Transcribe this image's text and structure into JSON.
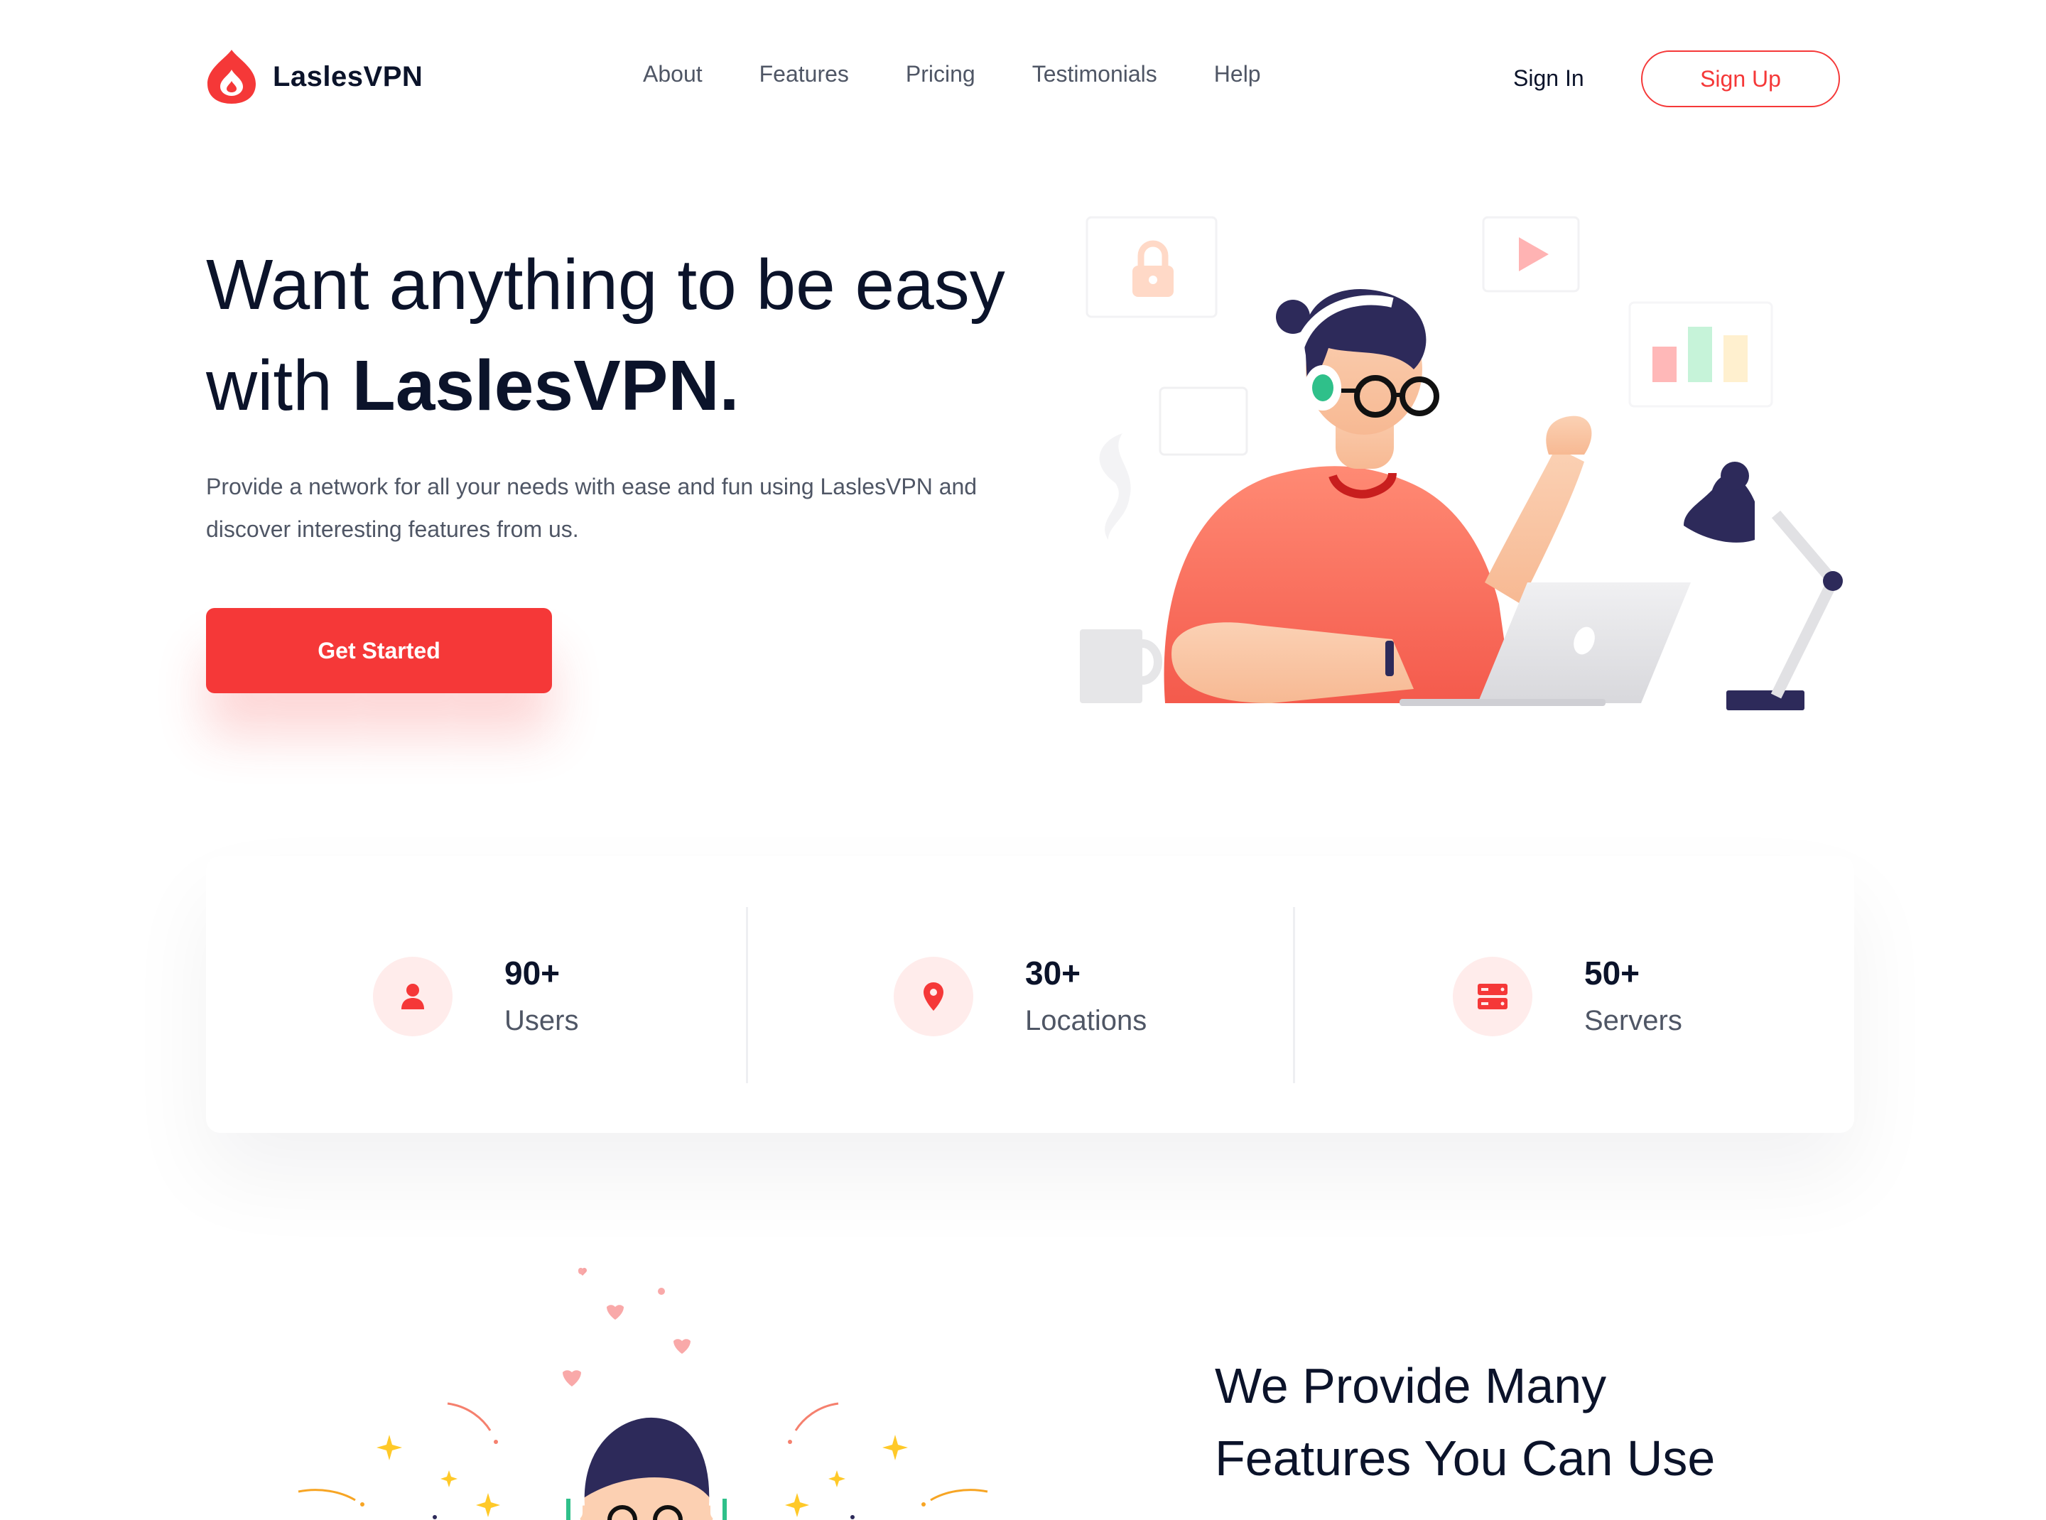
{
  "brand": {
    "name": "LaslesVPN",
    "accent": "#f53838",
    "dark": "#0b132a",
    "muted": "#4f5665"
  },
  "nav": {
    "links": [
      "About",
      "Features",
      "Pricing",
      "Testimonials",
      "Help"
    ],
    "sign_in": "Sign In",
    "sign_up": "Sign Up"
  },
  "hero": {
    "title_line1": "Want anything to be easy",
    "title_line2_prefix": "with ",
    "title_line2_bold": "LaslesVPN.",
    "description": "Provide a network for all your needs with ease and fun using LaslesVPN and discover interesting features from us.",
    "cta": "Get Started"
  },
  "stats": [
    {
      "value": "90+",
      "label": "Users",
      "icon": "user-icon"
    },
    {
      "value": "30+",
      "label": "Locations",
      "icon": "location-pin-icon"
    },
    {
      "value": "50+",
      "label": "Servers",
      "icon": "server-icon"
    }
  ],
  "features": {
    "title_line1": "We Provide Many",
    "title_line2": "Features You Can Use"
  }
}
